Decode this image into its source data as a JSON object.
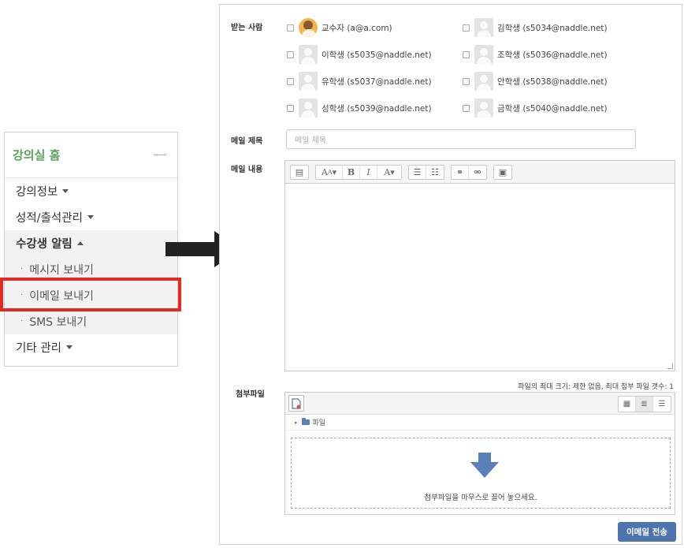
{
  "sidebar": {
    "title": "강의실 홈",
    "items": [
      {
        "label": "강의정보"
      },
      {
        "label": "성적/출석관리"
      },
      {
        "label": "수강생 알림"
      },
      {
        "label": "기타 관리"
      }
    ],
    "subitems": [
      {
        "label": "메시지 보내기"
      },
      {
        "label": "이메일 보내기"
      },
      {
        "label": "SMS 보내기"
      }
    ]
  },
  "form": {
    "recipients_label": "받는 사람",
    "recipients": [
      {
        "name": "교수자 (a@a.com)",
        "avatar": "professor-photo"
      },
      {
        "name": "김학생 (s5034@naddle.net)",
        "avatar": "default-user"
      },
      {
        "name": "이학생 (s5035@naddle.net)",
        "avatar": "default-user"
      },
      {
        "name": "조학생 (s5036@naddle.net)",
        "avatar": "default-user"
      },
      {
        "name": "유학생 (s5037@naddle.net)",
        "avatar": "default-user"
      },
      {
        "name": "안학생 (s5038@naddle.net)",
        "avatar": "default-user"
      },
      {
        "name": "성학생 (s5039@naddle.net)",
        "avatar": "default-user"
      },
      {
        "name": "금학생 (s5040@naddle.net)",
        "avatar": "default-user"
      }
    ],
    "subject_label": "메일 제목",
    "subject_placeholder": "메일 제목",
    "body_label": "메일 내용",
    "attach_label": "첨부파일",
    "file_limits": "파일의 최대 크기: 제한 없음, 최대 첨부 파일 갯수: 1",
    "folder_label": "파일",
    "drop_hint": "첨부파일을 마우스로 끌어 놓으세요.",
    "send_label": "이메일 전송"
  },
  "colors": {
    "sidebar_title": "#5aa35c",
    "highlight": "#e02b20",
    "send_button": "#4e74ad",
    "drop_arrow": "#5b7fb8"
  }
}
